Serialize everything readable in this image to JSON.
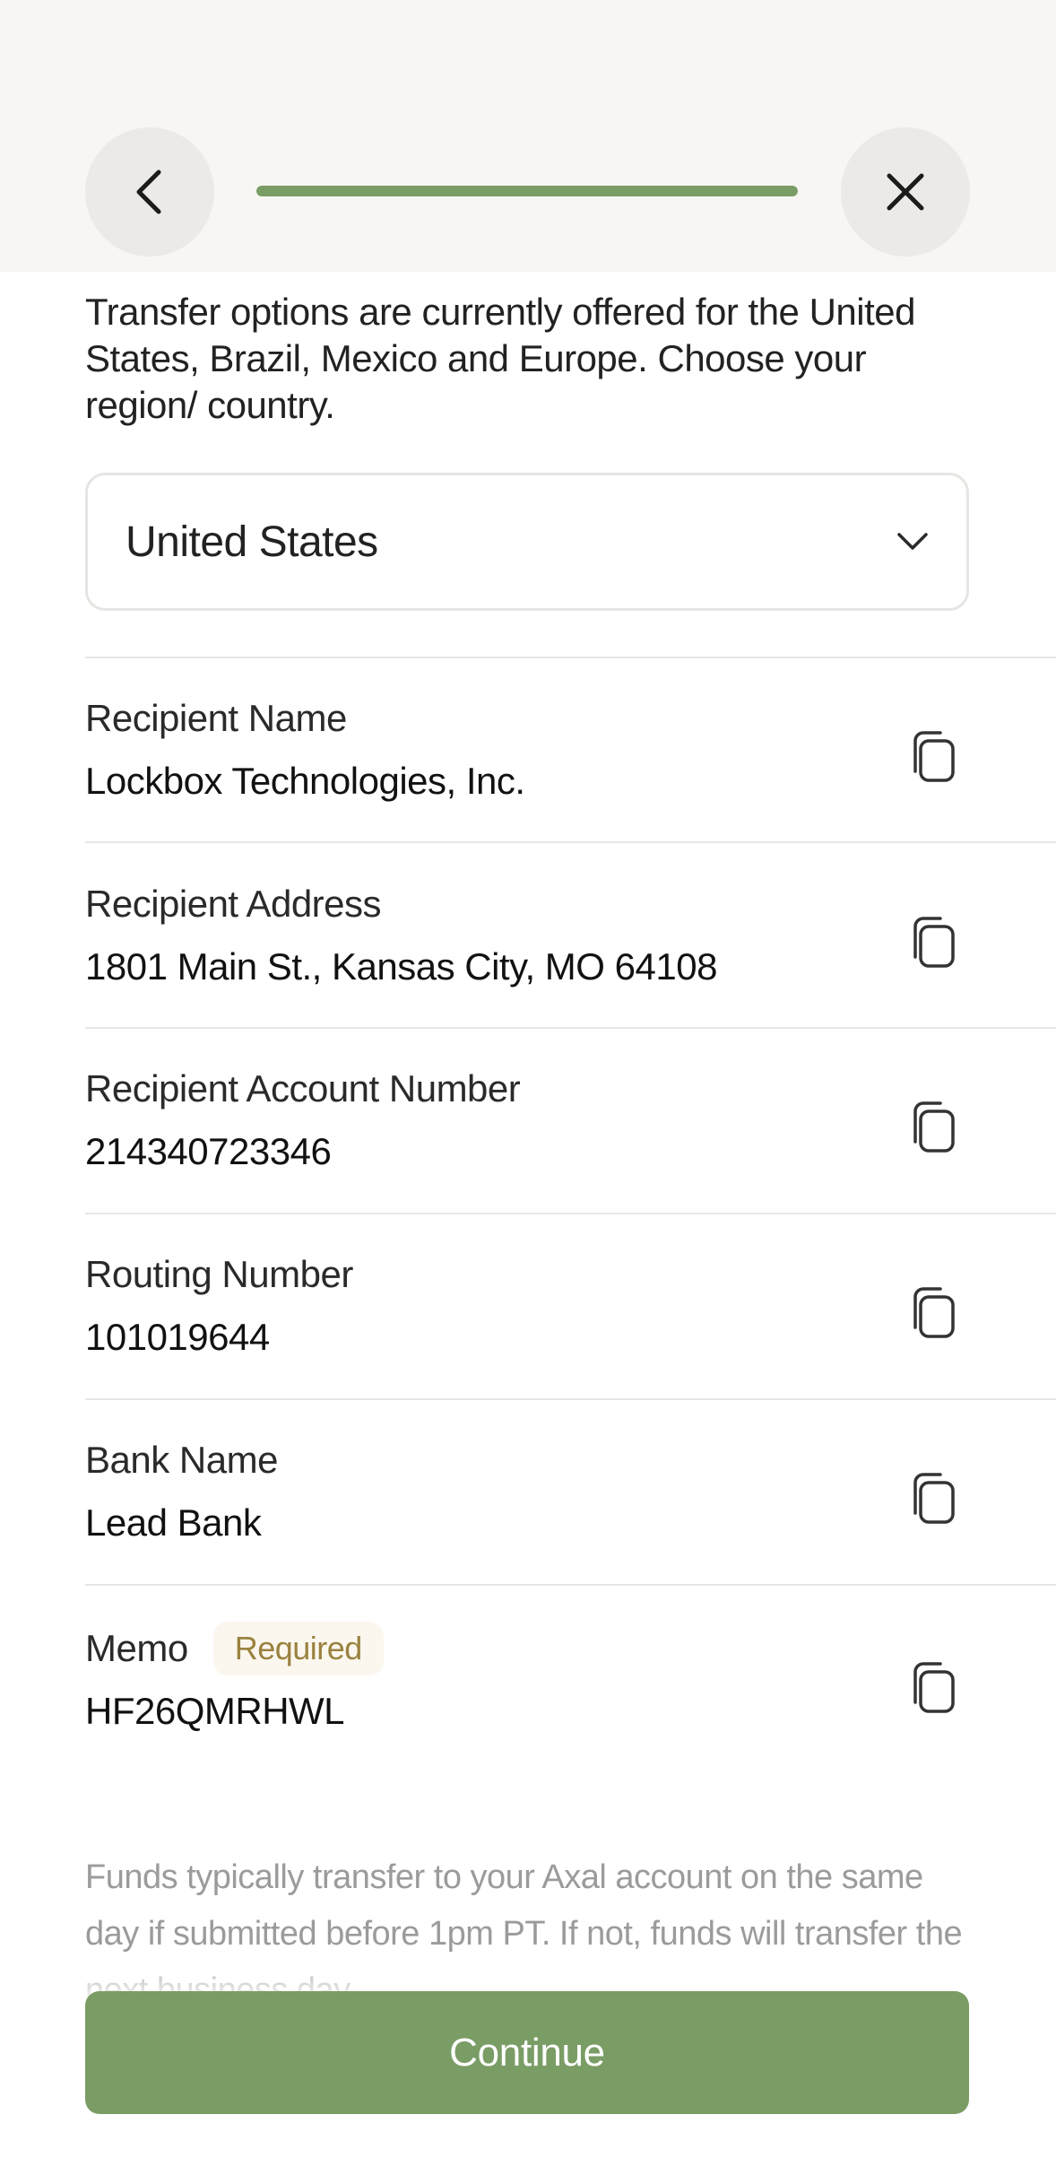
{
  "header": {
    "back_icon": "chevron-left-icon",
    "close_icon": "close-icon",
    "progress_percent": 100,
    "accent_color": "#7a9c65"
  },
  "intro": {
    "text": "Transfer options are currently offered for the United States, Brazil, Mexico and Europe. Choose your region/ country."
  },
  "region_select": {
    "value": "United States",
    "icon": "chevron-down-icon"
  },
  "details": [
    {
      "label": "Recipient Name",
      "value": "Lockbox Technologies, Inc."
    },
    {
      "label": "Recipient Address",
      "value": "1801 Main St., Kansas City, MO 64108"
    },
    {
      "label": "Recipient Account Number",
      "value": "214340723346"
    },
    {
      "label": "Routing Number",
      "value": "101019644"
    },
    {
      "label": "Bank Name",
      "value": "Lead Bank"
    },
    {
      "label": "Memo",
      "value": "HF26QMRHWL",
      "badge": "Required"
    }
  ],
  "copy_icon": "copy-icon",
  "footnote": "Funds typically transfer to your Axal account on the same day if submitted before 1pm PT. If not, funds will transfer the next business day.",
  "continue_label": "Continue"
}
